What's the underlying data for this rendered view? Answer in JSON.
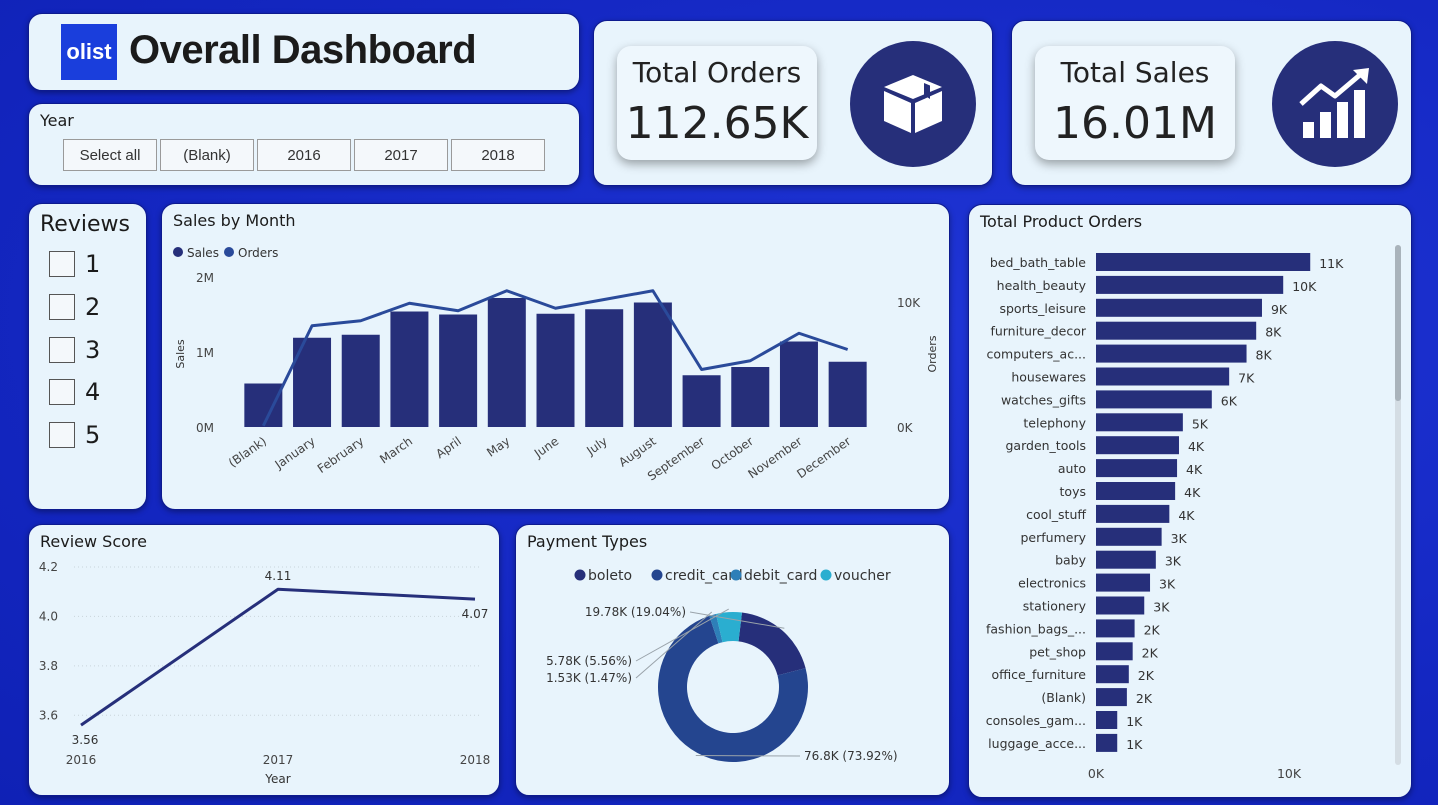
{
  "header": {
    "logo_text": "olist",
    "title": "Overall Dashboard"
  },
  "year_filter": {
    "label": "Year",
    "options": [
      "Select all",
      "(Blank)",
      "2016",
      "2017",
      "2018"
    ]
  },
  "kpis": {
    "orders": {
      "label": "Total Orders",
      "value": "112.65K",
      "icon": "package-box-icon"
    },
    "sales": {
      "label": "Total Sales",
      "value": "16.01M",
      "icon": "growth-chart-icon"
    }
  },
  "reviews_filter": {
    "label": "Reviews",
    "options": [
      "1",
      "2",
      "3",
      "4",
      "5"
    ]
  },
  "colors": {
    "bar": "#262f7a",
    "line": "#2a4a9a",
    "background": "#1a2bc8",
    "card": "#e8f4fc"
  },
  "chart_data": [
    {
      "id": "sales-by-month",
      "type": "bar",
      "title": "Sales by Month",
      "categories": [
        "(Blank)",
        "January",
        "February",
        "March",
        "April",
        "May",
        "June",
        "July",
        "August",
        "September",
        "October",
        "November",
        "December"
      ],
      "series": [
        {
          "name": "Sales",
          "type": "bar",
          "values": [
            0.58,
            1.19,
            1.23,
            1.54,
            1.5,
            1.72,
            1.51,
            1.57,
            1.66,
            0.69,
            0.8,
            1.14,
            0.87
          ]
        },
        {
          "name": "Orders",
          "type": "line",
          "values": [
            0.1,
            8.1,
            8.5,
            9.9,
            9.3,
            10.9,
            9.5,
            10.2,
            10.9,
            4.6,
            5.3,
            7.5,
            6.2
          ]
        }
      ],
      "ylabel": "Sales",
      "y2label": "Orders",
      "ylim": [
        0,
        2
      ],
      "y2lim": [
        0,
        10
      ],
      "yticks": [
        "0M",
        "1M",
        "2M"
      ],
      "y2ticks": [
        "0K",
        "10K"
      ],
      "legend": "top-left"
    },
    {
      "id": "total-product-orders",
      "type": "bar",
      "orientation": "horizontal",
      "title": "Total Product Orders",
      "categories": [
        "bed_bath_table",
        "health_beauty",
        "sports_leisure",
        "furniture_decor",
        "computers_ac...",
        "housewares",
        "watches_gifts",
        "telephony",
        "garden_tools",
        "auto",
        "toys",
        "cool_stuff",
        "perfumery",
        "baby",
        "electronics",
        "stationery",
        "fashion_bags_...",
        "pet_shop",
        "office_furniture",
        "(Blank)",
        "consoles_gam...",
        "luggage_acce..."
      ],
      "values": [
        11.1,
        9.7,
        8.6,
        8.3,
        7.8,
        6.9,
        6.0,
        4.5,
        4.3,
        4.2,
        4.1,
        3.8,
        3.4,
        3.1,
        2.8,
        2.5,
        2.0,
        1.9,
        1.7,
        1.6,
        1.1,
        1.1
      ],
      "labels": [
        "11K",
        "10K",
        "9K",
        "8K",
        "8K",
        "7K",
        "6K",
        "5K",
        "4K",
        "4K",
        "4K",
        "4K",
        "3K",
        "3K",
        "3K",
        "3K",
        "2K",
        "2K",
        "2K",
        "2K",
        "1K",
        "1K"
      ],
      "xlim": [
        0,
        10
      ],
      "xticks": [
        "0K",
        "10K"
      ]
    },
    {
      "id": "review-score",
      "type": "line",
      "title": "Review Score",
      "x": [
        "2016",
        "2017",
        "2018"
      ],
      "values": [
        3.56,
        4.11,
        4.07
      ],
      "labels": [
        "3.56",
        "4.11",
        "4.07"
      ],
      "xlabel": "Year",
      "ylim": [
        3.5,
        4.2
      ],
      "yticks": [
        "3.6",
        "3.8",
        "4.0",
        "4.2"
      ]
    },
    {
      "id": "payment-types",
      "type": "pie",
      "donut": true,
      "title": "Payment Types",
      "categories": [
        "boleto",
        "credit_card",
        "debit_card",
        "voucher"
      ],
      "values": [
        19.04,
        73.92,
        1.47,
        5.56
      ],
      "labels": [
        "19.78K (19.04%)",
        "76.8K (73.92%)",
        "1.53K (1.47%)",
        "5.78K (5.56%)"
      ],
      "colors": [
        "#262f7a",
        "#24458f",
        "#2e7fb8",
        "#2aaed0"
      ],
      "legend": "top"
    }
  ]
}
